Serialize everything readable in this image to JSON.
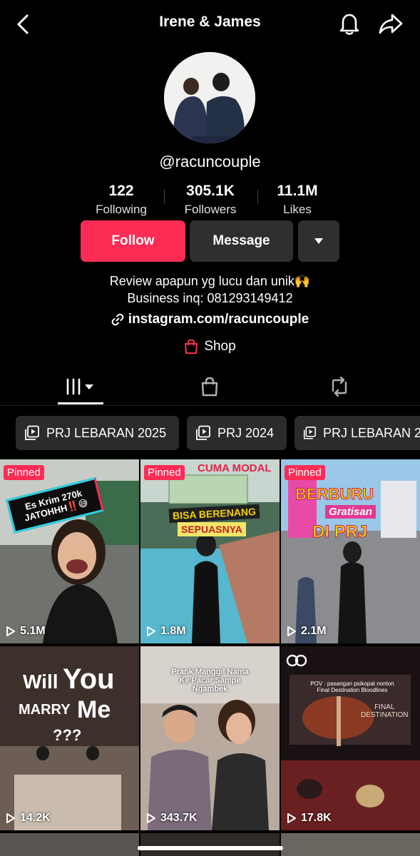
{
  "header": {
    "title": "Irene & James"
  },
  "profile": {
    "username": "@racuncouple",
    "stats": [
      {
        "value": "122",
        "label": "Following"
      },
      {
        "value": "305.1K",
        "label": "Followers"
      },
      {
        "value": "11.1M",
        "label": "Likes"
      }
    ],
    "follow_label": "Follow",
    "message_label": "Message",
    "bio_line1": "Review apapun yg lucu dan unik🙌",
    "bio_line2": "Business inq: 081293149412",
    "link": "instagram.com/racuncouple",
    "shop_label": "Shop"
  },
  "playlists": [
    {
      "label": "PRJ LEBARAN 2025"
    },
    {
      "label": "PRJ 2024"
    },
    {
      "label": "PRJ LEBARAN 2"
    }
  ],
  "videos": [
    {
      "pinned": "Pinned",
      "views": "5.1M",
      "overlay": [
        "Es Krim 270k",
        "JATOHHH‼️😅"
      ]
    },
    {
      "pinned": "Pinned",
      "views": "1.8M",
      "overlay": [
        "CUMA MODAL",
        "BISA BERENANG",
        "SEPUASNYA"
      ]
    },
    {
      "pinned": "Pinned",
      "views": "2.1M",
      "overlay": [
        "BERBURU",
        "Gratisan",
        "DI PRJ"
      ]
    },
    {
      "views": "14.2K",
      "overlay": [
        "Will",
        "You",
        "MARRY",
        "Me",
        "???"
      ]
    },
    {
      "views": "343.7K",
      "overlay": [
        "Prank Manggil Nama",
        "Ke Pacar Sampe Ngambek"
      ]
    },
    {
      "views": "17.8K",
      "overlay": [
        "POV : pasangan psikopat nonton",
        "Final Destination Bloodlines",
        "FINAL",
        "DESTINATION"
      ]
    }
  ],
  "colors": {
    "accent": "#fe2c55",
    "button_dark": "#2f2f2f",
    "background": "#000000"
  }
}
